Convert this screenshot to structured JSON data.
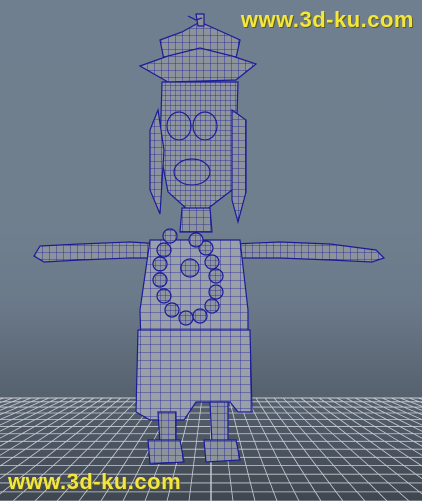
{
  "watermark": {
    "top": "www.3d-ku.com",
    "bottom": "www.3d-ku.com"
  },
  "colors": {
    "background": "#707f8e",
    "wire": "#1b1c9a",
    "mesh_fill": "#8c939b",
    "grid": "#c9cdd2",
    "watermark": "#f3e63c"
  },
  "icons": {
    "character": "wireframe-character-model",
    "grid": "perspective-ground-grid"
  }
}
